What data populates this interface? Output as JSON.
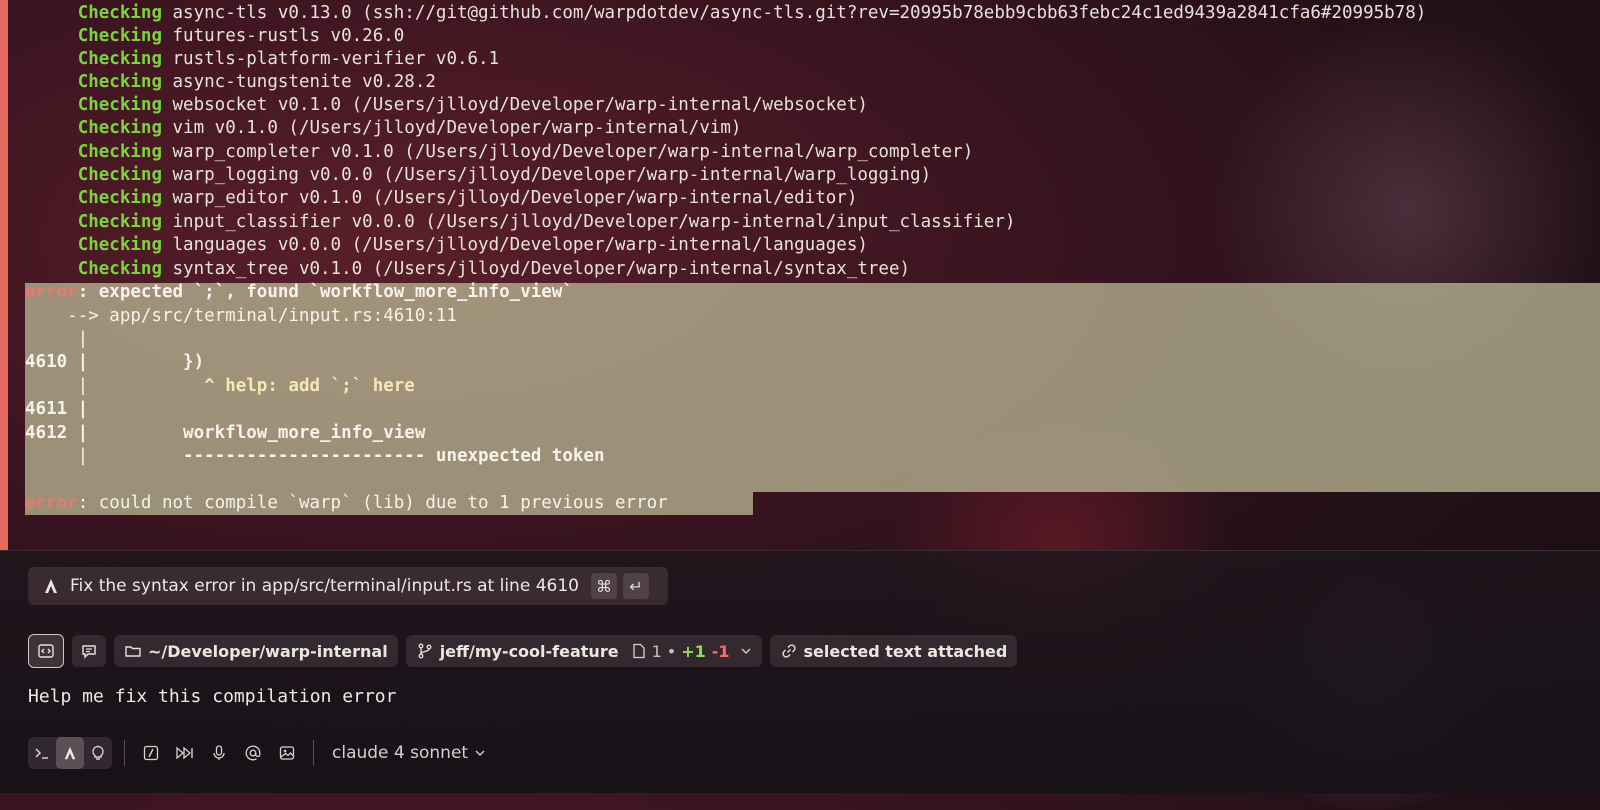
{
  "terminal": {
    "lines": [
      {
        "tag": "Checking",
        "rest": " async-tls v0.13.0 (ssh://git@github.com/warpdotdev/async-tls.git?rev=20995b78ebb9cbb63febc24c1ed9439a2841cfa6#20995b78)"
      },
      {
        "tag": "Checking",
        "rest": " futures-rustls v0.26.0"
      },
      {
        "tag": "Checking",
        "rest": " rustls-platform-verifier v0.6.1"
      },
      {
        "tag": "Checking",
        "rest": " async-tungstenite v0.28.2"
      },
      {
        "tag": "Checking",
        "rest": " websocket v0.1.0 (/Users/jlloyd/Developer/warp-internal/websocket)"
      },
      {
        "tag": "Checking",
        "rest": " vim v0.1.0 (/Users/jlloyd/Developer/warp-internal/vim)"
      },
      {
        "tag": "Checking",
        "rest": " warp_completer v0.1.0 (/Users/jlloyd/Developer/warp-internal/warp_completer)"
      },
      {
        "tag": "Checking",
        "rest": " warp_logging v0.0.0 (/Users/jlloyd/Developer/warp-internal/warp_logging)"
      },
      {
        "tag": "Checking",
        "rest": " warp_editor v0.1.0 (/Users/jlloyd/Developer/warp-internal/editor)"
      },
      {
        "tag": "Checking",
        "rest": " input_classifier v0.0.0 (/Users/jlloyd/Developer/warp-internal/input_classifier)"
      },
      {
        "tag": "Checking",
        "rest": " languages v0.0.0 (/Users/jlloyd/Developer/warp-internal/languages)"
      },
      {
        "tag": "Checking",
        "rest": " syntax_tree v0.1.0 (/Users/jlloyd/Developer/warp-internal/syntax_tree)"
      }
    ],
    "error": {
      "label": "error",
      "message": ": expected `;`, found `workflow_more_info_view`",
      "location": "    --> app/src/terminal/input.rs:4610:11",
      "pipe": "     |",
      "l4610": "4610 |         })",
      "help_prefix": "     |           ",
      "help": "^ help: add `;` here",
      "l4611": "4611 |",
      "l4612": "4612 |         workflow_more_info_view",
      "under_prefix": "     |         ",
      "under": "----------------------- unexpected token",
      "final_label": "error",
      "final_message": ": could not compile `warp` (lib) due to 1 previous error"
    }
  },
  "suggestion": {
    "text": "Fix the syntax error in app/src/terminal/input.rs at line 4610",
    "icon": "agent-icon",
    "shortcut_cmd": "⌘",
    "shortcut_enter": "↵"
  },
  "context": {
    "directory": "~/Developer/warp-internal",
    "branch": "jeff/my-cool-feature",
    "files_changed": "1",
    "dot": "•",
    "additions": "+1",
    "deletions": "-1",
    "attachment": "selected text attached"
  },
  "input": {
    "value": "Help me fix this compilation error"
  },
  "toolbar": {
    "model": "claude 4 sonnet"
  },
  "colors": {
    "accent_green": "#7bd43c",
    "error_red": "#e57b6d",
    "selection": "#b7b392"
  }
}
